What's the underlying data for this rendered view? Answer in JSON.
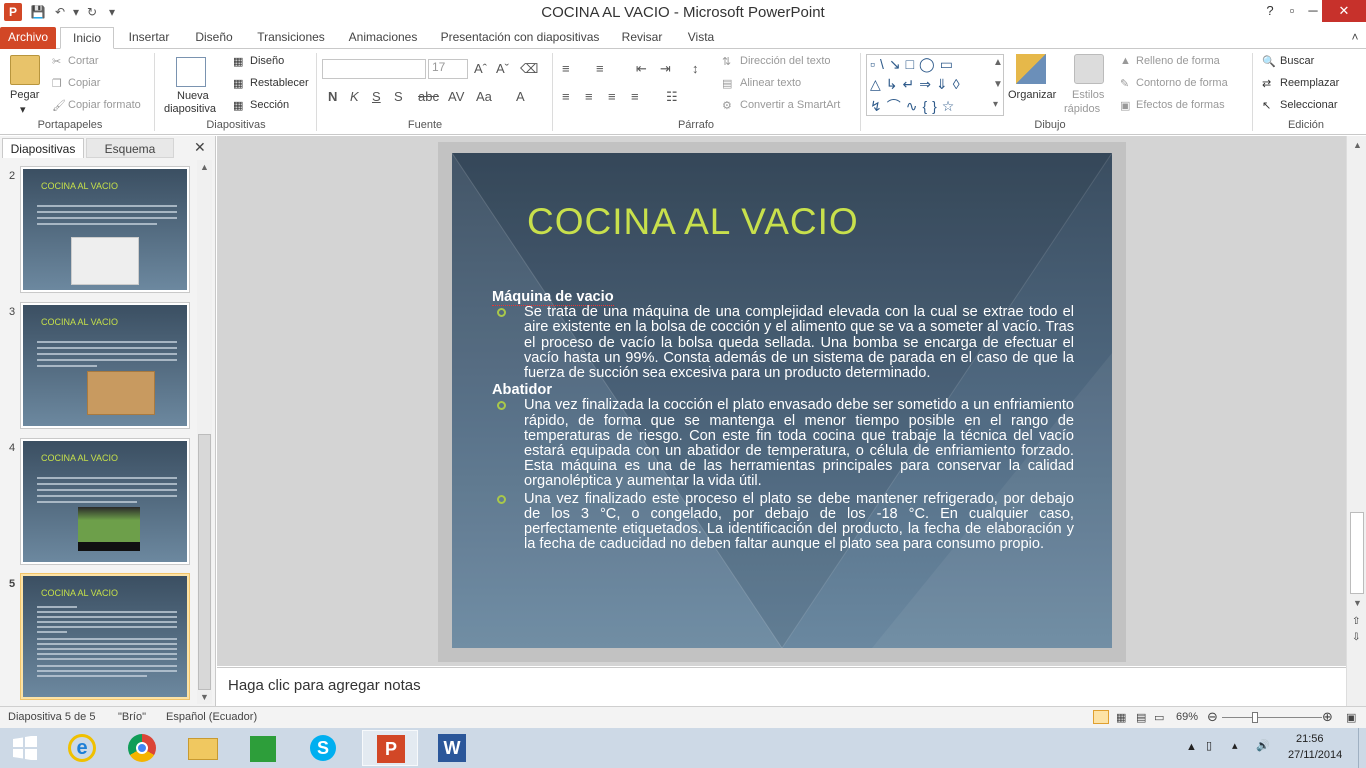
{
  "window": {
    "title": "COCINA AL VACIO  -  Microsoft PowerPoint",
    "app_letter": "P"
  },
  "tabs": [
    "Archivo",
    "Inicio",
    "Insertar",
    "Diseño",
    "Transiciones",
    "Animaciones",
    "Presentación con diapositivas",
    "Revisar",
    "Vista"
  ],
  "ribbon": {
    "clipboard": {
      "label": "Portapapeles",
      "paste": "Pegar",
      "cut": "Cortar",
      "copy": "Copiar",
      "format_painter": "Copiar formato"
    },
    "slides": {
      "label": "Diapositivas",
      "new_slide_1": "Nueva",
      "new_slide_2": "diapositiva",
      "layout": "Diseño",
      "reset": "Restablecer",
      "section": "Sección"
    },
    "font": {
      "label": "Fuente",
      "size": "17"
    },
    "paragraph": {
      "label": "Párrafo",
      "text_direction": "Dirección del texto",
      "align_text": "Alinear texto",
      "smartart": "Convertir a SmartArt"
    },
    "drawing": {
      "label": "Dibujo",
      "arrange": "Organizar",
      "quick_styles_1": "Estilos",
      "quick_styles_2": "rápidos",
      "shape_fill": "Relleno de forma",
      "shape_outline": "Contorno de forma",
      "shape_effects": "Efectos de formas"
    },
    "editing": {
      "label": "Edición",
      "find": "Buscar",
      "replace": "Reemplazar",
      "select": "Seleccionar"
    }
  },
  "pane_tabs": {
    "slides": "Diapositivas",
    "outline": "Esquema"
  },
  "thumbnails": [
    {
      "num": "2",
      "title": "COCINA AL VACIO"
    },
    {
      "num": "3",
      "title": "COCINA AL VACIO"
    },
    {
      "num": "4",
      "title": "COCINA AL VACIO"
    },
    {
      "num": "5",
      "title": "COCINA AL VACIO"
    }
  ],
  "slide": {
    "title": "COCINA AL VACIO",
    "heading1": "Máquina de vacio",
    "p1": "Se trata de una máquina de una complejidad elevada con la cual se extrae todo el aire existente en la bolsa de cocción y el alimento que se va a someter al vacío. Tras el proceso de vacío la bolsa queda sellada. Una bomba se encarga de efectuar el vacío hasta un 99%. Consta además de un sistema de parada en el caso de que la fuerza de succión sea excesiva para un producto determinado.",
    "heading2": "Abatidor",
    "p2": "Una vez finalizada la cocción el plato envasado debe ser sometido a un enfriamiento rápido, de forma que se mantenga el menor tiempo posible en el rango de temperaturas de riesgo. Con este fin toda cocina que trabaje la técnica del vacío estará equipada con un abatidor de temperatura, o célula de enfriamiento forzado. Esta máquina es una de las herramientas principales para conservar la calidad organoléptica y aumentar la vida útil.",
    "p3": "Una vez finalizado este proceso el plato se debe mantener refrigerado, por debajo de los 3 °C, o congelado, por debajo de los -18 °C. En cualquier caso, perfectamente etiquetados. La identificación del producto, la fecha de elaboración y la fecha de caducidad no deben faltar aunque el plato sea para consumo propio."
  },
  "notes_placeholder": "Haga clic para agregar notas",
  "status": {
    "slide_pos": "Diapositiva 5 de 5",
    "theme": "\"Brío\"",
    "language": "Español (Ecuador)",
    "zoom": "69%",
    "zoom_level_pct": 69
  },
  "clock": {
    "time": "21:56",
    "date": "27/11/2014"
  },
  "colors": {
    "accent": "#d24726",
    "title_green": "#c8e04c",
    "bullet": "#a9c84a"
  }
}
